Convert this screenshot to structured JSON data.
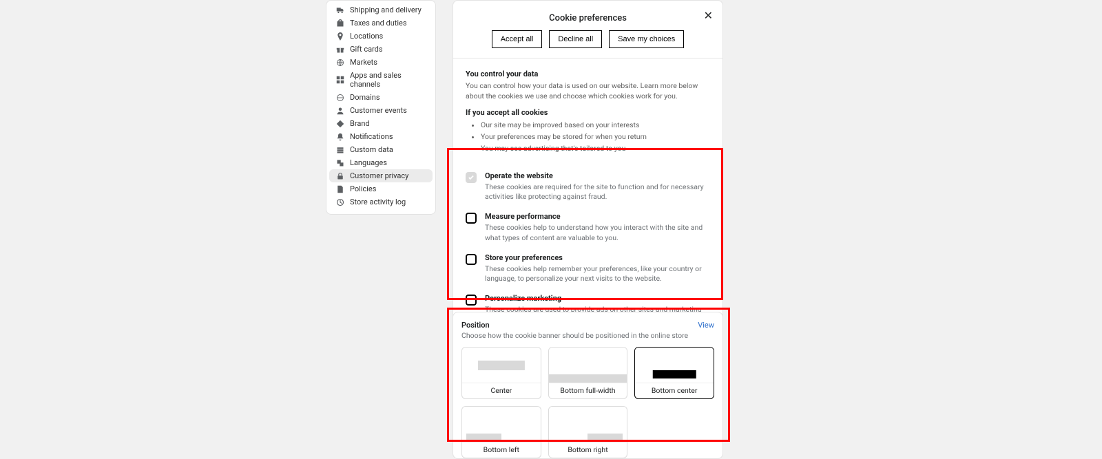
{
  "sidebar": {
    "items": [
      {
        "label": "Shipping and delivery",
        "icon": "truck-icon"
      },
      {
        "label": "Taxes and duties",
        "icon": "bag-icon"
      },
      {
        "label": "Locations",
        "icon": "pin-icon"
      },
      {
        "label": "Gift cards",
        "icon": "gift-icon"
      },
      {
        "label": "Markets",
        "icon": "globe-icon"
      },
      {
        "label": "Apps and sales channels",
        "icon": "grid-icon"
      },
      {
        "label": "Domains",
        "icon": "domain-icon"
      },
      {
        "label": "Customer events",
        "icon": "person-icon"
      },
      {
        "label": "Brand",
        "icon": "diamond-icon"
      },
      {
        "label": "Notifications",
        "icon": "bell-icon"
      },
      {
        "label": "Custom data",
        "icon": "data-icon"
      },
      {
        "label": "Languages",
        "icon": "language-icon"
      },
      {
        "label": "Customer privacy",
        "icon": "lock-icon",
        "active": true
      },
      {
        "label": "Policies",
        "icon": "document-icon"
      },
      {
        "label": "Store activity log",
        "icon": "clock-icon"
      }
    ]
  },
  "cookie_panel": {
    "title": "Cookie preferences",
    "buttons": {
      "accept_all": "Accept all",
      "decline_all": "Decline all",
      "save": "Save my choices"
    },
    "section1": {
      "heading": "You control your data",
      "body": "You can control how your data is used on our website. Learn more below about the cookies we use and choose which cookies work for you."
    },
    "section2": {
      "heading": "If you accept all cookies",
      "bullets": [
        "Our site may be improved based on your interests",
        "Your preferences may be stored for when you return",
        "You may see advertising that's tailored to you"
      ]
    },
    "categories": [
      {
        "title": "Operate the website",
        "desc": "These cookies are required for the site to function and for necessary activities like protecting against fraud.",
        "locked": true
      },
      {
        "title": "Measure performance",
        "desc": "These cookies help to understand how you interact with the site and what types of content are valuable to you.",
        "locked": false
      },
      {
        "title": "Store your preferences",
        "desc": "These cookies help remember your preferences, like your country or language, to personalize your next visits to the website.",
        "locked": false
      },
      {
        "title": "Personalize marketing",
        "desc": "These cookies are used to provide ads on other sites and marketing communications based on your interests.",
        "locked": false
      }
    ]
  },
  "position_panel": {
    "title": "Position",
    "subtitle": "Choose how the cookie banner should be positioned in the online store",
    "view_label": "View",
    "options": [
      {
        "label": "Center",
        "selected": false
      },
      {
        "label": "Bottom full-width",
        "selected": false
      },
      {
        "label": "Bottom center",
        "selected": true
      },
      {
        "label": "Bottom left",
        "selected": false
      },
      {
        "label": "Bottom right",
        "selected": false
      }
    ]
  }
}
